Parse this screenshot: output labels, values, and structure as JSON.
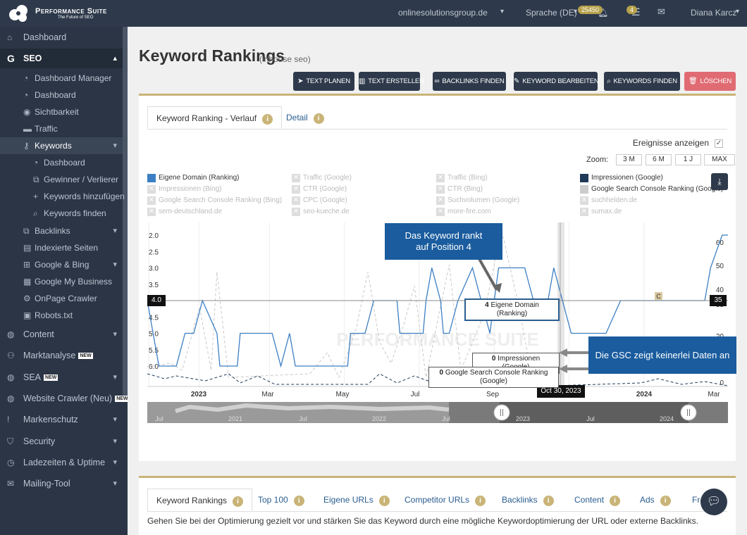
{
  "topbar": {
    "logo_title": "Performance Suite",
    "logo_subtitle": "The Future of SEO",
    "domain": "onlinesolutionsgroup.de",
    "language": "Sprache (DE)",
    "notif_count": "25450",
    "task_count": "4",
    "user": "Diana Karcz"
  },
  "sidebar": {
    "items": [
      {
        "label": "Dashboard",
        "icon": "home-icon"
      },
      {
        "label": "SEO",
        "icon": "google-g-icon"
      },
      {
        "label": "Dashboard Manager",
        "icon": "gauge-icon"
      },
      {
        "label": "Dashboard",
        "icon": "gauge-icon"
      },
      {
        "label": "Sichtbarkeit",
        "icon": "eye-icon"
      },
      {
        "label": "Traffic",
        "icon": "car-icon"
      },
      {
        "label": "Keywords",
        "icon": "key-icon"
      },
      {
        "label": "Dashboard",
        "icon": "gauge-icon"
      },
      {
        "label": "Gewinner / Verlierer",
        "icon": "external-link-icon"
      },
      {
        "label": "Keywords hinzufügen",
        "icon": "plus-icon"
      },
      {
        "label": "Keywords finden",
        "icon": "search-icon"
      },
      {
        "label": "Backlinks",
        "icon": "external-link-icon"
      },
      {
        "label": "Indexierte Seiten",
        "icon": "file-icon"
      },
      {
        "label": "Google & Bing",
        "icon": "sitemap-icon"
      },
      {
        "label": "Google My Business",
        "icon": "building-icon"
      },
      {
        "label": "OnPage Crawler",
        "icon": "crawler-icon"
      },
      {
        "label": "Robots.txt",
        "icon": "robot-icon"
      },
      {
        "label": "Content",
        "icon": "globe-icon"
      },
      {
        "label": "Marktanalyse",
        "icon": "users-icon",
        "badge": "NEW"
      },
      {
        "label": "SEA",
        "icon": "globe-icon",
        "badge": "NEW"
      },
      {
        "label": "Website Crawler (Neu)",
        "icon": "globe-icon",
        "badge": "NEW"
      },
      {
        "label": "Markenschutz",
        "icon": "exclamation-icon"
      },
      {
        "label": "Security",
        "icon": "shield-icon"
      },
      {
        "label": "Ladezeiten & Uptime",
        "icon": "speedometer-icon"
      },
      {
        "label": "Mailing-Tool",
        "icon": "envelope-icon"
      }
    ]
  },
  "page": {
    "title": "Keyword Rankings",
    "subtitle": "(inhouse seo)"
  },
  "actions": [
    {
      "label": "TEXT PLANEN",
      "icon": "paper-plane-icon"
    },
    {
      "label": "TEXT ERSTELLEN",
      "icon": "book-icon"
    },
    {
      "label": "BACKLINKS FINDEN",
      "icon": "link-icon"
    },
    {
      "label": "KEYWORD BEARBEITEN",
      "icon": "edit-icon"
    },
    {
      "label": "KEYWORDS FINDEN",
      "icon": "search-icon"
    },
    {
      "label": "LÖSCHEN",
      "icon": "trash-icon"
    }
  ],
  "tabs1": [
    {
      "label": "Keyword Ranking - Verlauf",
      "active": true
    },
    {
      "label": "Detail",
      "active": false
    }
  ],
  "events_label": "Ereignisse anzeigen",
  "zoom": {
    "label": "Zoom:",
    "buttons": [
      "3 M",
      "6 M",
      "1 J",
      "MAX"
    ]
  },
  "legend": [
    {
      "label": "Eigene Domain (Ranking)",
      "on": true,
      "color": "#3c7fc4"
    },
    {
      "label": "Traffic (Google)",
      "on": false
    },
    {
      "label": "Traffic (Bing)",
      "on": false
    },
    {
      "label": "Impressionen (Google)",
      "on": true,
      "color": "#1f3b57"
    },
    {
      "label": "Impressionen (Bing)",
      "on": false
    },
    {
      "label": "CTR (Google)",
      "on": false
    },
    {
      "label": "CTR (Bing)",
      "on": false
    },
    {
      "label": "Google Search Console Ranking (Google)",
      "on": true,
      "color": "#cccccc"
    },
    {
      "label": "Google Search Console Ranking (Bing)",
      "on": false
    },
    {
      "label": "CPC (Google)",
      "on": false
    },
    {
      "label": "Suchvolumen (Google)",
      "on": false
    },
    {
      "label": "suchhelden.de",
      "on": false
    },
    {
      "label": "sem-deutschland.de",
      "on": false
    },
    {
      "label": "seo-kueche.de",
      "on": false
    },
    {
      "label": "more-fire.com",
      "on": false
    },
    {
      "label": "sumax.de",
      "on": false
    }
  ],
  "chart_data": {
    "type": "line",
    "x_ticks": [
      "2023",
      "Mar",
      "May",
      "Jul",
      "Sep",
      "Nov",
      "2024",
      "Mar"
    ],
    "y_left_ticks": [
      "2.0",
      "2.5",
      "3.0",
      "3.5",
      "4.0",
      "4.5",
      "5.0",
      "5.5",
      "6.0"
    ],
    "y_left_range": [
      2.0,
      6.0
    ],
    "y_left_inverted": true,
    "y_right_ticks": [
      "60",
      "50",
      "40",
      "35",
      "20",
      "0"
    ],
    "y_right_range": [
      0,
      60
    ],
    "series": [
      {
        "name": "Eigene Domain (Ranking)",
        "color": "#3c7fc4",
        "points": [
          [
            0,
            4.0
          ],
          [
            0.02,
            6.0
          ],
          [
            0.05,
            6.0
          ],
          [
            0.065,
            5.0
          ],
          [
            0.08,
            5.0
          ],
          [
            0.095,
            4.0
          ],
          [
            0.12,
            5.0
          ],
          [
            0.125,
            6.0
          ],
          [
            0.155,
            6.0
          ],
          [
            0.16,
            5.0
          ],
          [
            0.215,
            5.0
          ],
          [
            0.23,
            6.0
          ],
          [
            0.245,
            5.0
          ],
          [
            0.255,
            6.0
          ],
          [
            0.345,
            6.0
          ],
          [
            0.35,
            5.0
          ],
          [
            0.375,
            5.0
          ],
          [
            0.39,
            4.0
          ],
          [
            0.43,
            4.0
          ],
          [
            0.435,
            5.0
          ],
          [
            0.475,
            5.0
          ],
          [
            0.48,
            4.0
          ],
          [
            0.49,
            3.0
          ],
          [
            0.505,
            4.0
          ],
          [
            0.51,
            5.0
          ],
          [
            0.52,
            5.0
          ],
          [
            0.535,
            4.0
          ],
          [
            0.56,
            3.0
          ],
          [
            0.59,
            5.0
          ],
          [
            0.605,
            3.0
          ],
          [
            0.65,
            3.0
          ],
          [
            0.665,
            4.0
          ],
          [
            0.69,
            4.0
          ],
          [
            0.7,
            3.0
          ],
          [
            0.73,
            5.0
          ],
          [
            0.79,
            5.0
          ],
          [
            0.815,
            4.0
          ],
          [
            0.96,
            4.0
          ],
          [
            0.97,
            3.0
          ],
          [
            0.99,
            2.0
          ],
          [
            1.0,
            2.0
          ]
        ]
      },
      {
        "name": "Impressionen (Google)",
        "color": "#1f3b57",
        "value_at_tooltip": 0
      },
      {
        "name": "Google Search Console Ranking (Google)",
        "color": "#cccccc",
        "value_at_tooltip": 0
      }
    ],
    "tooltip": {
      "date": "Oct 30, 2023",
      "rows": [
        {
          "value": "4",
          "label": "Eigene Domain (Ranking)"
        },
        {
          "value": "0",
          "label": "Impressionen (Google)"
        },
        {
          "value": "0",
          "label": "Google Search Console Ranking (Google)"
        }
      ]
    },
    "left_marker": "4.0",
    "right_marker": "35",
    "event_marker": "C",
    "navigator_ticks": [
      "Jul",
      "2021",
      "Jul",
      "2022",
      "Jul",
      "2023",
      "Jul",
      "2024"
    ]
  },
  "annotations": [
    "Das Keyword rankt auf Position 4",
    "Die GSC zeigt keinerlei Daten an"
  ],
  "tabs2": [
    {
      "label": "Keyword Rankings",
      "active": true
    },
    {
      "label": "Top 100"
    },
    {
      "label": "Eigene URLs"
    },
    {
      "label": "Competitor URLs"
    },
    {
      "label": "Backlinks"
    },
    {
      "label": "Content"
    },
    {
      "label": "Ads"
    },
    {
      "label": "Fra"
    }
  ],
  "description": "Gehen Sie bei der Optimierung gezielt vor und stärken Sie das Keyword durch eine mögliche Keywordoptimierung der URL oder externe Backlinks."
}
